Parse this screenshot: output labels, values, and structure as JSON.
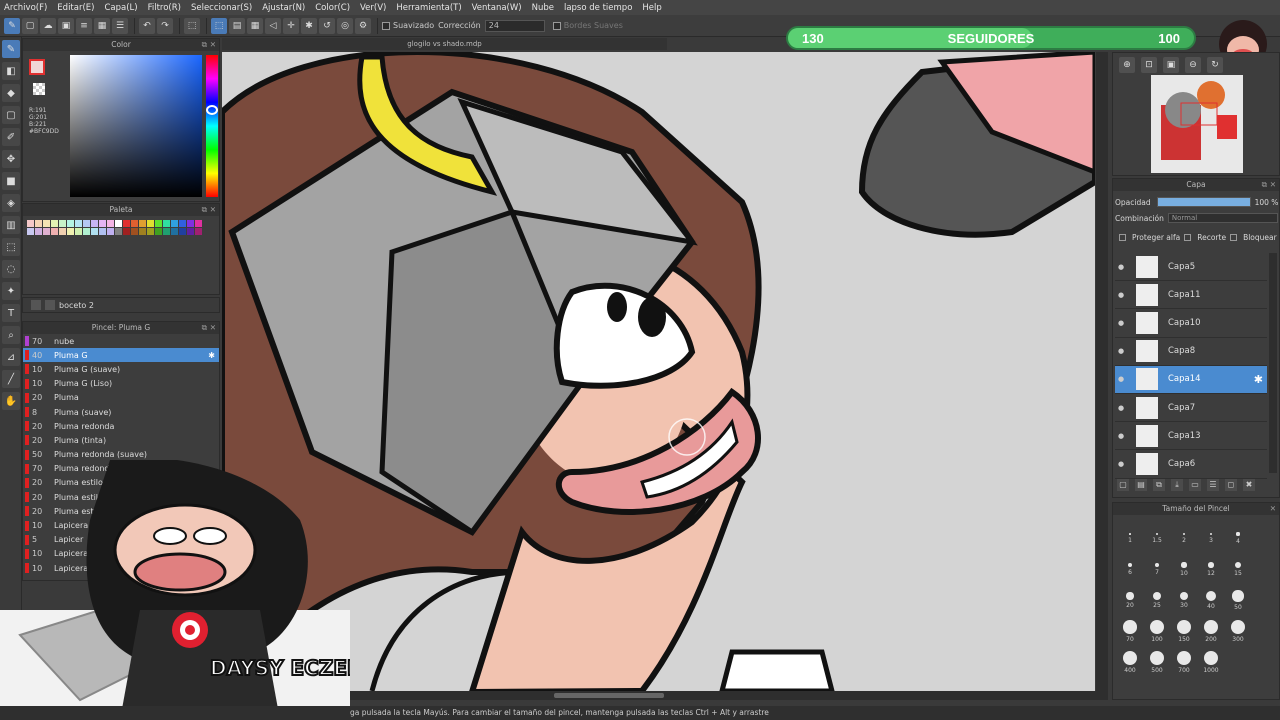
{
  "menu": [
    "Archivo(F)",
    "Editar(E)",
    "Capa(L)",
    "Filtro(R)",
    "Seleccionar(S)",
    "Ajustar(N)",
    "Color(C)",
    "Ver(V)",
    "Herramienta(T)",
    "Ventana(W)",
    "Nube",
    "lapso de tiempo",
    "Help"
  ],
  "toolbar": {
    "suavizado": "Suavizado",
    "correccion": "Corrección",
    "correccion_value": "24",
    "bordes": "Bordes Suaves"
  },
  "color_panel": {
    "title": "Color",
    "rgb": [
      "R:191",
      "G:201",
      "B:221"
    ],
    "hex": "#BFC9DD"
  },
  "palette_panel": {
    "title": "Paleta"
  },
  "layer_name": "boceto 2",
  "brush_panel": {
    "title": "Pincel: Pluma G",
    "items": [
      {
        "size": "70",
        "name": "nube",
        "color": "#b040d0"
      },
      {
        "size": "40",
        "name": "Pluma G",
        "color": "#e02020",
        "selected": true
      },
      {
        "size": "10",
        "name": "Pluma G (suave)",
        "color": "#e02020"
      },
      {
        "size": "10",
        "name": "Pluma G (Liso)",
        "color": "#e02020"
      },
      {
        "size": "20",
        "name": "Pluma",
        "color": "#e02020"
      },
      {
        "size": "8",
        "name": "Pluma (suave)",
        "color": "#e02020"
      },
      {
        "size": "20",
        "name": "Pluma redonda",
        "color": "#e02020"
      },
      {
        "size": "20",
        "name": "Pluma (tinta)",
        "color": "#e02020"
      },
      {
        "size": "50",
        "name": "Pluma redonda (suave)",
        "color": "#e02020"
      },
      {
        "size": "70",
        "name": "Pluma redonda (Liso)",
        "color": "#e02020"
      },
      {
        "size": "20",
        "name": "Pluma estilográfica",
        "color": "#e02020"
      },
      {
        "size": "20",
        "name": "Pluma estilog",
        "color": "#e02020"
      },
      {
        "size": "20",
        "name": "Pluma estil",
        "color": "#e02020"
      },
      {
        "size": "10",
        "name": "Lapicera F",
        "color": "#e02020"
      },
      {
        "size": "5",
        "name": "Lapicer",
        "color": "#e02020"
      },
      {
        "size": "10",
        "name": "Lapicera",
        "color": "#e02020"
      },
      {
        "size": "10",
        "name": "Lapicera",
        "color": "#e02020"
      }
    ]
  },
  "canvas": {
    "tab_title": "glogilo vs shado.mdp"
  },
  "followers": {
    "left": "130",
    "label": "SEGUIDORES",
    "right": "100",
    "progress": 0.6
  },
  "layer_panel": {
    "title": "Capa",
    "opacity_label": "Opacidad",
    "opacity_value": "100 %",
    "blend_label": "Combinación",
    "blend_value": "Normal",
    "protect_alpha": "Proteger alfa",
    "clip": "Recorte",
    "lock": "Bloquear",
    "layers": [
      {
        "name": "Capa5"
      },
      {
        "name": "Capa11"
      },
      {
        "name": "Capa10"
      },
      {
        "name": "Capa8"
      },
      {
        "name": "Capa14",
        "selected": true
      },
      {
        "name": "Capa7"
      },
      {
        "name": "Capa13"
      },
      {
        "name": "Capa6"
      }
    ]
  },
  "size_panel": {
    "title": "Tamaño del Pincel",
    "sizes": [
      "1",
      "1.5",
      "2",
      "3",
      "4",
      "6",
      "7",
      "10",
      "12",
      "15",
      "20",
      "25",
      "30",
      "40",
      "50",
      "70",
      "100",
      "150",
      "200",
      "300",
      "400",
      "500",
      "700",
      "1000"
    ]
  },
  "status_text": "ga pulsada la tecla Mayús. Para cambiar el tamaño del pincel, mantenga pulsada las teclas Ctrl + Alt y arrastre",
  "overlay_text": "DAYSY ECZEMA"
}
